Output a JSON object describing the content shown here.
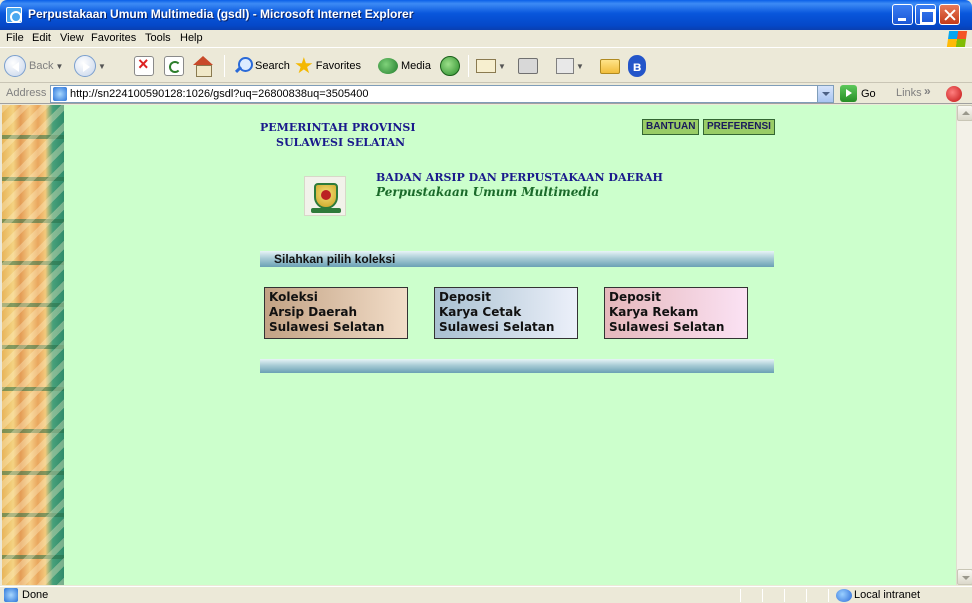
{
  "window": {
    "title": "Perpustakaan Umum Multimedia (gsdl) - Microsoft Internet Explorer"
  },
  "menu": {
    "items": [
      "File",
      "Edit",
      "View",
      "Favorites",
      "Tools",
      "Help"
    ]
  },
  "toolbar": {
    "back_label": "Back",
    "search_label": "Search",
    "favorites_label": "Favorites",
    "media_label": "Media"
  },
  "address": {
    "label": "Address",
    "url": "http://sn224100590128:1026/gsdl?uq=26800838uq=3505400",
    "go_label": "Go",
    "links_label": "Links",
    "links_chevron": "»"
  },
  "page": {
    "province_line1": "PEMERINTAH PROVINSI",
    "province_line2": "SULAWESI SELATAN",
    "help_button": "BANTUAN",
    "preferences_button": "PREFERENSI",
    "agency_line1": "BADAN ARSIP DAN PERPUSTAKAAN  DAERAH",
    "agency_line2": "Perpustakaan Umum Multimedia",
    "section_title": "Silahkan pilih koleksi",
    "collections": [
      {
        "lines": [
          "Koleksi",
          "Arsip Daerah",
          "Sulawesi Selatan"
        ]
      },
      {
        "lines": [
          "Deposit",
          "Karya Cetak",
          "Sulawesi Selatan"
        ]
      },
      {
        "lines": [
          "Deposit",
          "Karya Rekam",
          "Sulawesi Selatan"
        ]
      }
    ]
  },
  "status": {
    "text": "Done",
    "zone": "Local intranet"
  },
  "colors": {
    "page_background": "#ccffcc",
    "title_bar": "#0a5fe8",
    "heading_text": "#1a1a8c",
    "subtitle_text": "#1a6a2a"
  }
}
